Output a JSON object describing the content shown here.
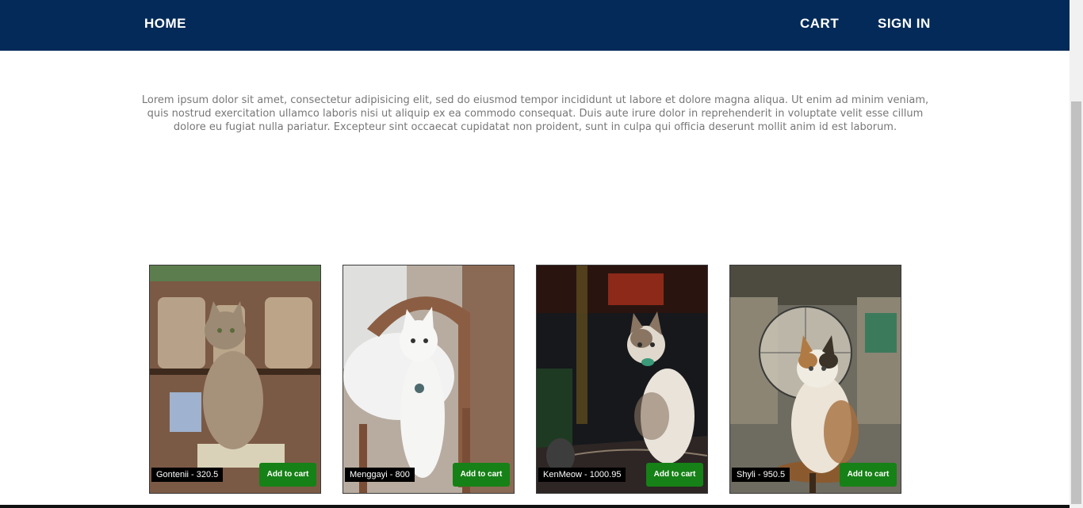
{
  "nav": {
    "home_label": "HOME",
    "cart_label": "CART",
    "signin_label": "SIGN IN"
  },
  "intro": {
    "text": "Lorem ipsum dolor sit amet, consectetur adipisicing elit, sed do eiusmod tempor incididunt ut labore et dolore magna aliqua. Ut enim ad minim veniam, quis nostrud exercitation ullamco laboris nisi ut aliquip ex ea commodo consequat. Duis aute irure dolor in reprehenderit in voluptate velit esse cillum dolore eu fugiat nulla pariatur. Excepteur sint occaecat cupidatat non proident, sunt in culpa qui officia deserunt mollit anim id est laborum."
  },
  "products": [
    {
      "caption": "Gontenii - 320.5",
      "button": "Add to cart"
    },
    {
      "caption": "Menggayi - 800",
      "button": "Add to cart"
    },
    {
      "caption": "KenMeow - 1000.95",
      "button": "Add to cart"
    },
    {
      "caption": "Shyli - 950.5",
      "button": "Add to cart"
    }
  ],
  "colors": {
    "navbar": "#032a58",
    "button": "#168116",
    "text": "#777777"
  }
}
